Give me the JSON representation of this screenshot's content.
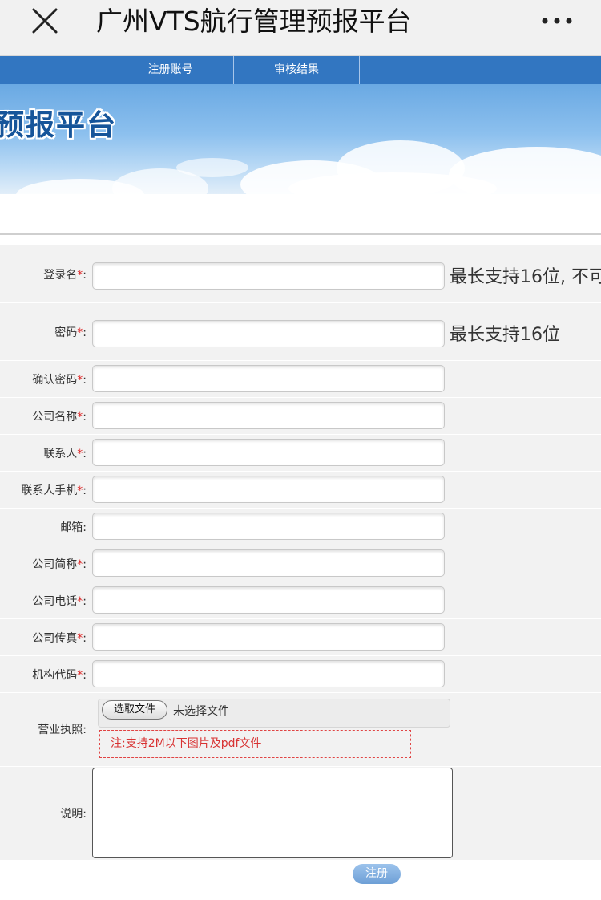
{
  "appbar": {
    "title": "广州VTS航行管理预报平台",
    "close_icon": "close-icon",
    "more_icon": "more-horizontal-icon"
  },
  "nav": {
    "items": [
      {
        "label": "注册账号"
      },
      {
        "label": "审核结果"
      }
    ]
  },
  "banner": {
    "title": "预报平台"
  },
  "form": {
    "required_mark": "*",
    "colon": ":",
    "fields": {
      "login_name": {
        "label": "登录名",
        "hint": "最长支持16位, 不可"
      },
      "password": {
        "label": "密码",
        "hint": "最长支持16位"
      },
      "confirm_password": {
        "label": "确认密码"
      },
      "company_name": {
        "label": "公司名称"
      },
      "contact": {
        "label": "联系人"
      },
      "contact_phone": {
        "label": "联系人手机"
      },
      "email": {
        "label": "邮箱"
      },
      "company_short": {
        "label": "公司简称"
      },
      "company_tel": {
        "label": "公司电话"
      },
      "company_fax": {
        "label": "公司传真"
      },
      "org_code": {
        "label": "机构代码"
      },
      "license": {
        "label": "营业执照",
        "button": "选取文件",
        "status": "未选择文件",
        "note": "注:支持2M以下图片及pdf文件"
      },
      "description": {
        "label": "说明"
      }
    },
    "submit_label": "注册"
  },
  "colors": {
    "nav_blue": "#3276c1",
    "banner_text": "#16559a",
    "required": "#dd2222",
    "form_bg": "#f2f2f2"
  }
}
